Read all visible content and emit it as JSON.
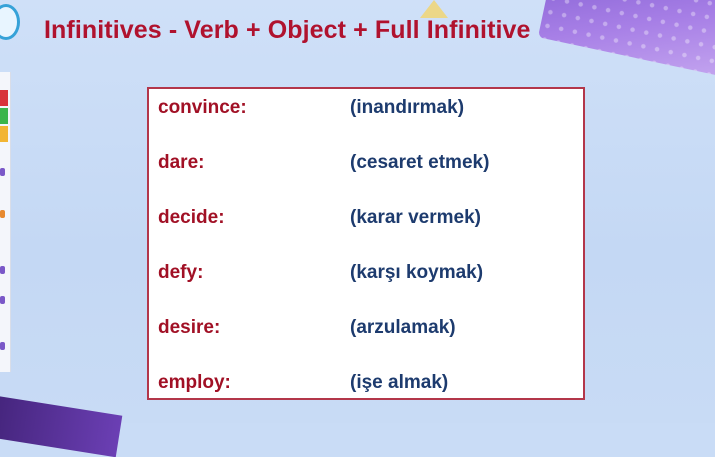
{
  "slide": {
    "title": "Infinitives - Verb + Object + Full Infinitive",
    "colors": {
      "title": "#b0122e",
      "term": "#a11025",
      "meaning": "#1d3b6e",
      "box_border": "#b3364a",
      "background": "#c9dcf6"
    },
    "vocab": [
      {
        "term": "convince:",
        "meaning": "(inandırmak)"
      },
      {
        "term": "dare:",
        "meaning": "(cesaret etmek)"
      },
      {
        "term": "decide:",
        "meaning": "(karar vermek)"
      },
      {
        "term": "defy:",
        "meaning": "(karşı koymak)"
      },
      {
        "term": "desire:",
        "meaning": "(arzulamak)"
      },
      {
        "term": "employ:",
        "meaning": "(işe almak)"
      }
    ]
  }
}
